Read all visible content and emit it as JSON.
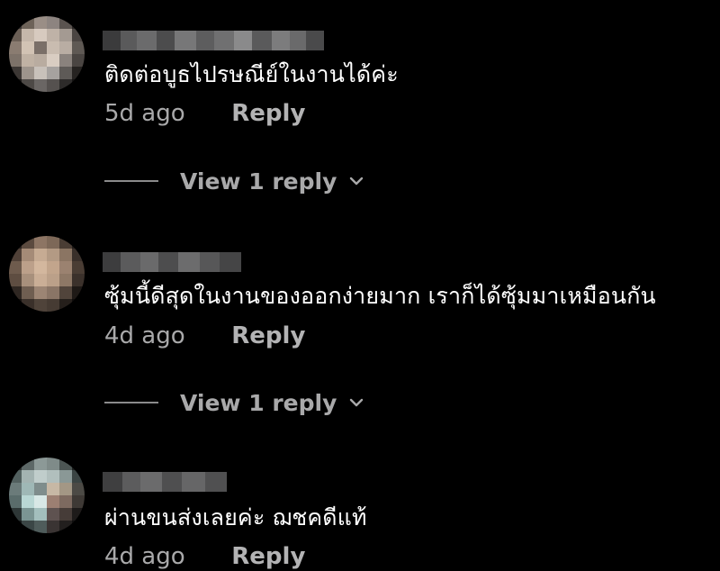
{
  "theme": {
    "background": "#000000",
    "text": "#ffffff",
    "muted": "#a9a9aa"
  },
  "comments": [
    {
      "avatar": "blurred-avatar",
      "username": "blurred-username",
      "text": "ติดต่อบูธไปรษณีย์ในงานได้ค่ะ",
      "time": "5d ago",
      "reply_label": "Reply",
      "view_replies_label": "View 1 reply",
      "view_replies_icon": "chevron-down-icon"
    },
    {
      "avatar": "blurred-avatar",
      "username": "blurred-username",
      "text": "ซุ้มนี้ดีสุดในงานของออกง่ายมาก เราก็ได้ซุ้มมาเหมือนกัน",
      "time": "4d ago",
      "reply_label": "Reply",
      "view_replies_label": "View 1 reply",
      "view_replies_icon": "chevron-down-icon"
    },
    {
      "avatar": "blurred-avatar",
      "username": "blurred-username",
      "text": "ผ่านขนส่งเลยค่ะ ฌชคดีแท้",
      "time": "4d ago",
      "reply_label": "Reply"
    }
  ]
}
